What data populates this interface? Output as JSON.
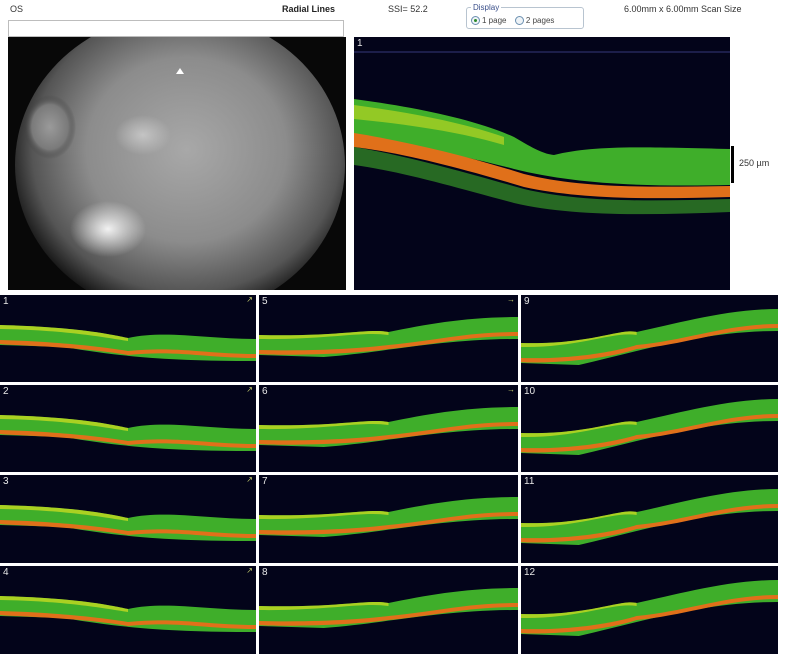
{
  "header": {
    "eye": "OS",
    "title": "Radial Lines",
    "ssi": "SSI= 52.2",
    "scan_size": "6.00mm x 6.00mm Scan Size"
  },
  "display": {
    "legend": "Display",
    "options": [
      {
        "label": "1 page",
        "selected": true
      },
      {
        "label": "2 pages",
        "selected": false
      }
    ]
  },
  "main_scan": {
    "label": "1",
    "scale": "250 µm"
  },
  "scans": [
    {
      "label": "1",
      "arrow": "↗"
    },
    {
      "label": "2",
      "arrow": "↗"
    },
    {
      "label": "3",
      "arrow": "↗"
    },
    {
      "label": "4",
      "arrow": "↗"
    },
    {
      "label": "5",
      "arrow": "→"
    },
    {
      "label": "6",
      "arrow": "→"
    },
    {
      "label": "7",
      "arrow": ""
    },
    {
      "label": "8",
      "arrow": ""
    },
    {
      "label": "9",
      "arrow": ""
    },
    {
      "label": "10",
      "arrow": ""
    },
    {
      "label": "11",
      "arrow": ""
    },
    {
      "label": "12",
      "arrow": ""
    }
  ],
  "colors": {
    "scan_background": "#03041a",
    "retina_green": "#3fae2a",
    "retina_yellow": "#d8e020",
    "rpe_orange": "#e0701a"
  }
}
